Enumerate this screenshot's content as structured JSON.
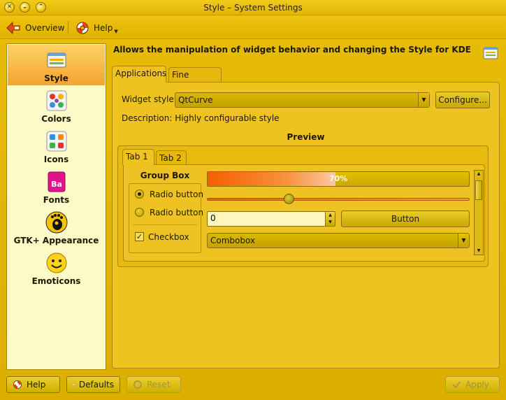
{
  "window": {
    "title": "Style – System Settings"
  },
  "titlebar_buttons": [
    "close",
    "minimize",
    "maximize"
  ],
  "toolbar": {
    "overview_label": "Overview",
    "help_label": "Help"
  },
  "sidebar": {
    "items": [
      {
        "label": "Style",
        "icon": "style-icon",
        "selected": true
      },
      {
        "label": "Colors",
        "icon": "colors-icon",
        "selected": false
      },
      {
        "label": "Icons",
        "icon": "icons-icon",
        "selected": false
      },
      {
        "label": "Fonts",
        "icon": "fonts-icon",
        "selected": false
      },
      {
        "label": "GTK+ Appearance",
        "icon": "gtk-icon",
        "selected": false
      },
      {
        "label": "Emoticons",
        "icon": "emoticons-icon",
        "selected": false
      }
    ]
  },
  "main": {
    "header": "Allows the manipulation of widget behavior and changing the Style for KDE",
    "tabs": [
      {
        "label": "Applications",
        "active": true
      },
      {
        "label": "Fine Tuning",
        "active": false
      }
    ],
    "widget_style_label": "Widget style:",
    "widget_style_value": "QtCurve",
    "configure_label": "Configure...",
    "description": "Description: Highly configurable style",
    "preview_title": "Preview"
  },
  "preview": {
    "tabs": [
      {
        "label": "Tab 1",
        "active": true
      },
      {
        "label": "Tab 2",
        "active": false
      }
    ],
    "group_box_title": "Group Box",
    "radio1_label": "Radio button",
    "radio1_checked": true,
    "radio2_label": "Radio button",
    "radio2_checked": false,
    "checkbox_label": "Checkbox",
    "checkbox_checked": true,
    "progress_text": "70%",
    "progress_value": 0.7,
    "slider_value": 0.31,
    "spin_value": "0",
    "button_label": "Button",
    "combobox_label": "Combobox"
  },
  "bottom": {
    "help_label": "Help",
    "defaults_label": "Defaults",
    "reset_label": "Reset",
    "apply_label": "Apply"
  },
  "colors": {
    "window_bg": "#e3b400",
    "selection_gradient_top": "#fdd065",
    "selection_gradient_bottom": "#f5a431",
    "progress_fill": "#f55f00",
    "sidebar_bg": "#fffbc8"
  }
}
